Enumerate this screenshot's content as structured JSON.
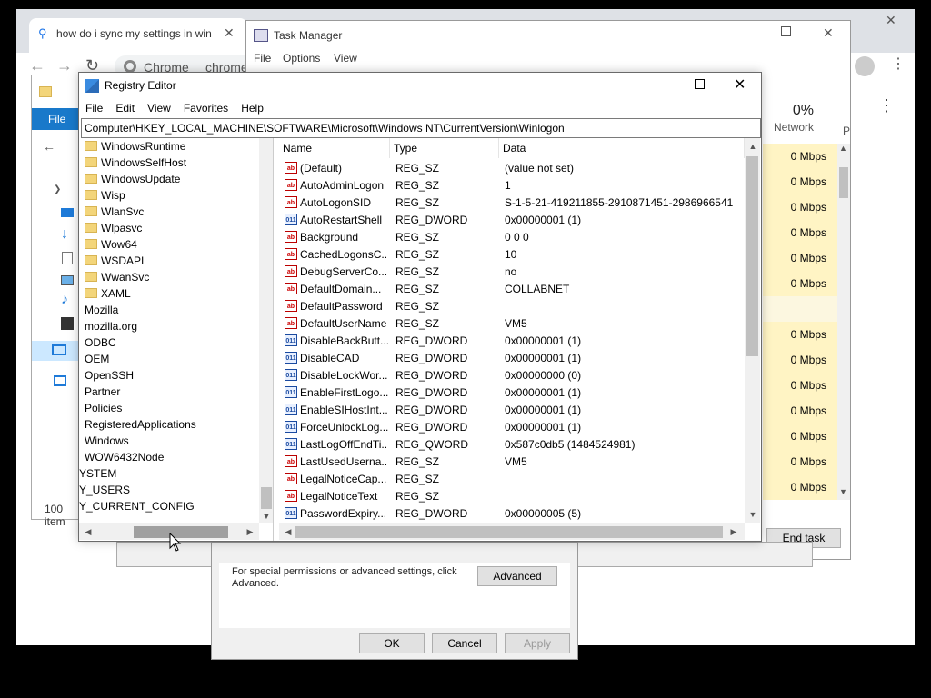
{
  "chrome": {
    "tab_title": "how do i sync my settings in win",
    "omnibox_label": "Chrome",
    "omnibox_text": "chrome"
  },
  "explorer": {
    "file_label": "File",
    "status": "100 item"
  },
  "task_manager": {
    "title": "Task Manager",
    "menu": [
      "File",
      "Options",
      "View"
    ],
    "network_percent": "0%",
    "network_header": "Network",
    "next_column_initial": "P",
    "network_values": [
      "0 Mbps",
      "0 Mbps",
      "0 Mbps",
      "0 Mbps",
      "0 Mbps",
      "0 Mbps",
      "",
      "0 Mbps",
      "0 Mbps",
      "0 Mbps",
      "0 Mbps",
      "0 Mbps",
      "0 Mbps",
      "0 Mbps",
      "0 Mbps"
    ],
    "end_task_label": "End task"
  },
  "security_dialog": {
    "note": "For special permissions or advanced settings, click Advanced.",
    "advanced_label": "Advanced",
    "ok_label": "OK",
    "cancel_label": "Cancel",
    "apply_label": "Apply"
  },
  "regedit": {
    "title": "Registry Editor",
    "menu": [
      "File",
      "Edit",
      "View",
      "Favorites",
      "Help"
    ],
    "address": "Computer\\HKEY_LOCAL_MACHINE\\SOFTWARE\\Microsoft\\Windows NT\\CurrentVersion\\Winlogon",
    "tree": [
      {
        "label": "WindowsRuntime",
        "indent": 2
      },
      {
        "label": "WindowsSelfHost",
        "indent": 2
      },
      {
        "label": "WindowsUpdate",
        "indent": 2
      },
      {
        "label": "Wisp",
        "indent": 2
      },
      {
        "label": "WlanSvc",
        "indent": 2
      },
      {
        "label": "Wlpasvc",
        "indent": 2
      },
      {
        "label": "Wow64",
        "indent": 2
      },
      {
        "label": "WSDAPI",
        "indent": 2
      },
      {
        "label": "WwanSvc",
        "indent": 2
      },
      {
        "label": "XAML",
        "indent": 2
      },
      {
        "label": "Mozilla",
        "indent": 1
      },
      {
        "label": "mozilla.org",
        "indent": 1
      },
      {
        "label": "ODBC",
        "indent": 1
      },
      {
        "label": "OEM",
        "indent": 1
      },
      {
        "label": "OpenSSH",
        "indent": 1
      },
      {
        "label": "Partner",
        "indent": 1
      },
      {
        "label": "Policies",
        "indent": 1
      },
      {
        "label": "RegisteredApplications",
        "indent": 1
      },
      {
        "label": "Windows",
        "indent": 1
      },
      {
        "label": "WOW6432Node",
        "indent": 1
      },
      {
        "label": "YSTEM",
        "indent": 0
      },
      {
        "label": "Y_USERS",
        "indent": 0
      },
      {
        "label": "Y_CURRENT_CONFIG",
        "indent": 0
      }
    ],
    "columns": [
      "Name",
      "Type",
      "Data"
    ],
    "values": [
      {
        "name": "(Default)",
        "type": "REG_SZ",
        "data": "(value not set)",
        "icon": "string"
      },
      {
        "name": "AutoAdminLogon",
        "type": "REG_SZ",
        "data": "1",
        "icon": "string"
      },
      {
        "name": "AutoLogonSID",
        "type": "REG_SZ",
        "data": "S-1-5-21-419211855-2910871451-2986966541",
        "icon": "string"
      },
      {
        "name": "AutoRestartShell",
        "type": "REG_DWORD",
        "data": "0x00000001 (1)",
        "icon": "binary"
      },
      {
        "name": "Background",
        "type": "REG_SZ",
        "data": "0 0 0",
        "icon": "string"
      },
      {
        "name": "CachedLogonsC...",
        "type": "REG_SZ",
        "data": "10",
        "icon": "string"
      },
      {
        "name": "DebugServerCo...",
        "type": "REG_SZ",
        "data": "no",
        "icon": "string"
      },
      {
        "name": "DefaultDomain...",
        "type": "REG_SZ",
        "data": "COLLABNET",
        "icon": "string"
      },
      {
        "name": "DefaultPassword",
        "type": "REG_SZ",
        "data": "",
        "icon": "string"
      },
      {
        "name": "DefaultUserName",
        "type": "REG_SZ",
        "data": "VM5",
        "icon": "string"
      },
      {
        "name": "DisableBackButt...",
        "type": "REG_DWORD",
        "data": "0x00000001 (1)",
        "icon": "binary"
      },
      {
        "name": "DisableCAD",
        "type": "REG_DWORD",
        "data": "0x00000001 (1)",
        "icon": "binary"
      },
      {
        "name": "DisableLockWor...",
        "type": "REG_DWORD",
        "data": "0x00000000 (0)",
        "icon": "binary"
      },
      {
        "name": "EnableFirstLogo...",
        "type": "REG_DWORD",
        "data": "0x00000001 (1)",
        "icon": "binary"
      },
      {
        "name": "EnableSIHostInt...",
        "type": "REG_DWORD",
        "data": "0x00000001 (1)",
        "icon": "binary"
      },
      {
        "name": "ForceUnlockLog...",
        "type": "REG_DWORD",
        "data": "0x00000001 (1)",
        "icon": "binary"
      },
      {
        "name": "LastLogOffEndTi...",
        "type": "REG_QWORD",
        "data": "0x587c0db5 (1484524981)",
        "icon": "binary"
      },
      {
        "name": "LastUsedUserna...",
        "type": "REG_SZ",
        "data": "VM5",
        "icon": "string"
      },
      {
        "name": "LegalNoticeCap...",
        "type": "REG_SZ",
        "data": "",
        "icon": "string"
      },
      {
        "name": "LegalNoticeText",
        "type": "REG_SZ",
        "data": "",
        "icon": "string"
      },
      {
        "name": "PasswordExpiry...",
        "type": "REG_DWORD",
        "data": "0x00000005 (5)",
        "icon": "binary"
      }
    ]
  }
}
